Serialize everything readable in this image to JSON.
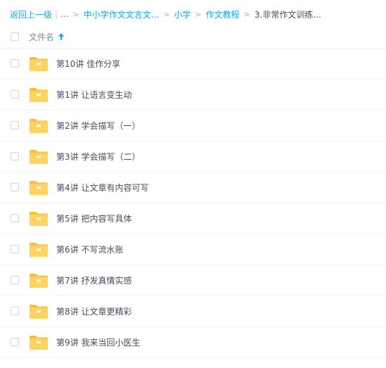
{
  "breadcrumb": {
    "back": "返回上一级",
    "separator_bar": "|",
    "ellipsis": "...",
    "items": [
      "中小学作文文言文...",
      "小学",
      "作文教程"
    ],
    "current": "3.非常作文训练...",
    "arrow": ">"
  },
  "list_header": {
    "name_label": "文件名"
  },
  "files": [
    {
      "name": "第10讲 佳作分享"
    },
    {
      "name": "第1讲 让语言变生动"
    },
    {
      "name": "第2讲 学会描写（一）"
    },
    {
      "name": "第3讲 学会描写（二）"
    },
    {
      "name": "第4讲 让文章有内容可写"
    },
    {
      "name": "第5讲 把内容写具体"
    },
    {
      "name": "第6讲 不写流水账"
    },
    {
      "name": "第7讲 抒发真情实感"
    },
    {
      "name": "第8讲 让文章更精彩"
    },
    {
      "name": "第9讲 我来当回小医生"
    }
  ],
  "icons": {
    "folder": "folder-icon",
    "sort": "sort-ascending-icon"
  },
  "colors": {
    "link": "#06a7ff",
    "folder_body": "#ffd05a",
    "folder_tab": "#fbc13f",
    "text": "#454d5a"
  }
}
